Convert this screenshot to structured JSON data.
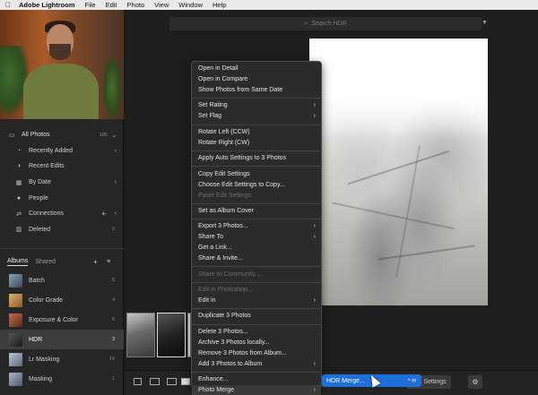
{
  "menubar": {
    "app_name": "Adobe Lightroom",
    "items": [
      "File",
      "Edit",
      "Photo",
      "View",
      "Window",
      "Help"
    ]
  },
  "sidebar": {
    "all_photos": {
      "label": "All Photos",
      "count": "185"
    },
    "items": [
      {
        "label": "Recently Added",
        "icon": "clock-icon"
      },
      {
        "label": "Recent Edits",
        "icon": "edit-icon"
      },
      {
        "label": "By Date",
        "icon": "calendar-icon"
      },
      {
        "label": "People",
        "icon": "person-icon"
      },
      {
        "label": "Connections",
        "icon": "connections-icon"
      },
      {
        "label": "Deleted",
        "icon": "trash-icon",
        "count": "2"
      }
    ],
    "tabs": {
      "albums": "Albums",
      "shared": "Shared"
    },
    "albums": [
      {
        "label": "Batch",
        "count": "5",
        "color": "#6b7a8a"
      },
      {
        "label": "Color Grade",
        "count": "4",
        "color": "#c08a4a"
      },
      {
        "label": "Exposure & Color",
        "count": "5",
        "color": "#a0522d"
      },
      {
        "label": "HDR",
        "count": "3",
        "color": "#2a2a2a"
      },
      {
        "label": "Lr Masking",
        "count": "14",
        "color": "#8aa0b8"
      },
      {
        "label": "Masking",
        "count": "1",
        "color": "#7a8a9a"
      }
    ]
  },
  "search": {
    "placeholder": "Search HDR"
  },
  "context_menu": {
    "groups": [
      [
        {
          "label": "Open in Detail"
        },
        {
          "label": "Open in Compare"
        },
        {
          "label": "Show Photos from Same Date"
        }
      ],
      [
        {
          "label": "Set Rating",
          "submenu": true
        },
        {
          "label": "Set Flag",
          "submenu": true
        }
      ],
      [
        {
          "label": "Rotate Left (CCW)"
        },
        {
          "label": "Rotate Right (CW)"
        }
      ],
      [
        {
          "label": "Apply Auto Settings to 3 Photos"
        }
      ],
      [
        {
          "label": "Copy Edit Settings"
        },
        {
          "label": "Choose Edit Settings to Copy..."
        },
        {
          "label": "Paste Edit Settings",
          "disabled": true
        }
      ],
      [
        {
          "label": "Set as Album Cover"
        }
      ],
      [
        {
          "label": "Export 3 Photos...",
          "submenu": true
        },
        {
          "label": "Share To",
          "submenu": true
        },
        {
          "label": "Get a Link..."
        },
        {
          "label": "Share & Invite..."
        }
      ],
      [
        {
          "label": "Share to Community...",
          "disabled": true
        }
      ],
      [
        {
          "label": "Edit in Photoshop...",
          "disabled": true
        },
        {
          "label": "Edit in",
          "submenu": true
        }
      ],
      [
        {
          "label": "Duplicate 3 Photos"
        }
      ],
      [
        {
          "label": "Delete 3 Photos..."
        },
        {
          "label": "Archive 3 Photos locally..."
        },
        {
          "label": "Remove 3 Photos from Album..."
        },
        {
          "label": "Add 3 Photos to Album",
          "submenu": true
        }
      ],
      [
        {
          "label": "Enhance..."
        },
        {
          "label": "Photo Merge",
          "submenu": true,
          "highlighted": true
        }
      ]
    ]
  },
  "submenu": {
    "label": "HDR Merge...",
    "shortcut": "^ H"
  },
  "bottom_toolbar": {
    "edit_settings_label": "Edit Settings"
  },
  "colors": {
    "accent": "#1e6fd9",
    "menu_bg": "#2b2b2b",
    "panel_bg": "#262626"
  }
}
